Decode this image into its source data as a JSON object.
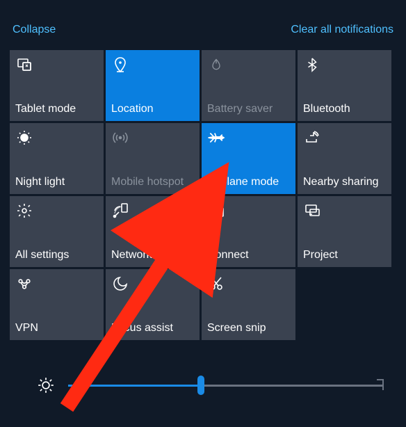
{
  "header": {
    "collapse": "Collapse",
    "clear": "Clear all notifications"
  },
  "tiles": [
    {
      "id": "tablet-mode",
      "label": "Tablet mode",
      "icon": "tablet-mode-icon",
      "active": false,
      "dim": false
    },
    {
      "id": "location",
      "label": "Location",
      "icon": "location-icon",
      "active": true,
      "dim": false
    },
    {
      "id": "battery-saver",
      "label": "Battery saver",
      "icon": "battery-saver-icon",
      "active": false,
      "dim": true
    },
    {
      "id": "bluetooth",
      "label": "Bluetooth",
      "icon": "bluetooth-icon",
      "active": false,
      "dim": false
    },
    {
      "id": "night-light",
      "label": "Night light",
      "icon": "night-light-icon",
      "active": false,
      "dim": false
    },
    {
      "id": "mobile-hotspot",
      "label": "Mobile hotspot",
      "icon": "mobile-hotspot-icon",
      "active": false,
      "dim": true
    },
    {
      "id": "airplane-mode",
      "label": "Airplane mode",
      "icon": "airplane-icon",
      "active": true,
      "dim": false
    },
    {
      "id": "nearby-sharing",
      "label": "Nearby sharing",
      "icon": "nearby-sharing-icon",
      "active": false,
      "dim": false
    },
    {
      "id": "all-settings",
      "label": "All settings",
      "icon": "settings-icon",
      "active": false,
      "dim": false
    },
    {
      "id": "network",
      "label": "Network",
      "icon": "network-icon",
      "active": false,
      "dim": false
    },
    {
      "id": "connect",
      "label": "Connect",
      "icon": "connect-icon",
      "active": false,
      "dim": false
    },
    {
      "id": "project",
      "label": "Project",
      "icon": "project-icon",
      "active": false,
      "dim": false
    },
    {
      "id": "vpn",
      "label": "VPN",
      "icon": "vpn-icon",
      "active": false,
      "dim": false
    },
    {
      "id": "focus-assist",
      "label": "Focus assist",
      "icon": "focus-assist-icon",
      "active": false,
      "dim": false
    },
    {
      "id": "screen-snip",
      "label": "Screen snip",
      "icon": "screen-snip-icon",
      "active": false,
      "dim": false
    }
  ],
  "brightness": {
    "percent": 42
  },
  "annotation": {
    "color": "#ff2a12",
    "target": "airplane-mode"
  }
}
